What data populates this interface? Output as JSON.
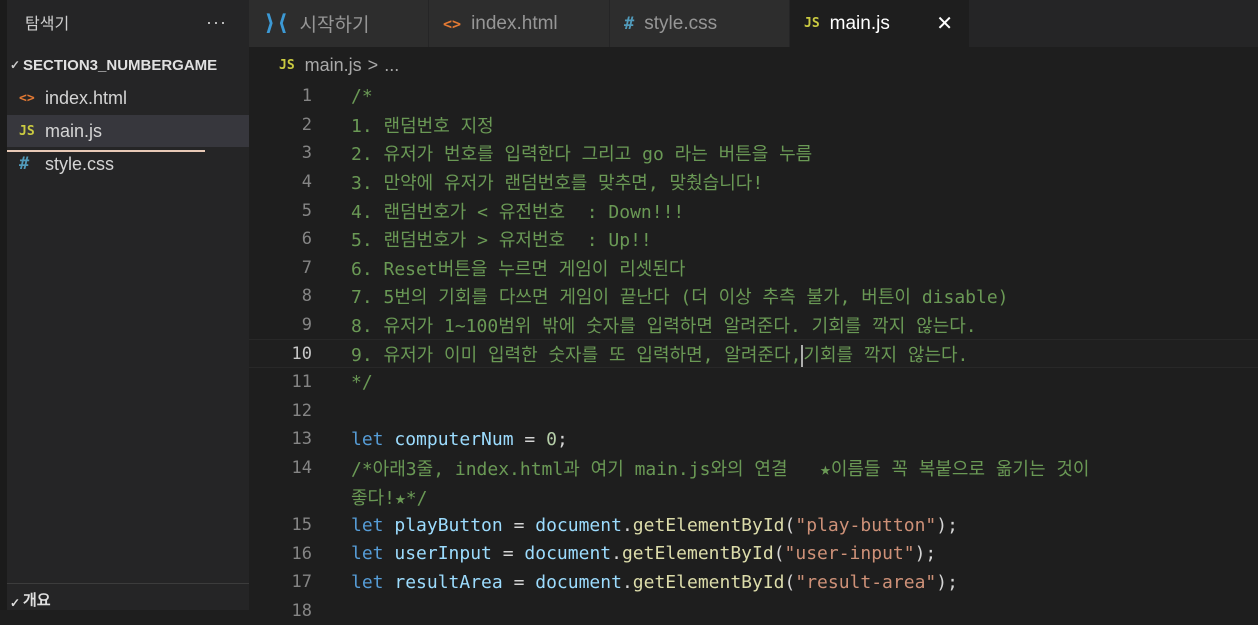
{
  "sidebar": {
    "title": "탐색기",
    "more": "···",
    "folder": "SECTION3_NUMBERGAME",
    "files": [
      {
        "name": "index.html",
        "icon": "<>"
      },
      {
        "name": "main.js",
        "icon": "JS"
      },
      {
        "name": "style.css",
        "icon": "#"
      }
    ],
    "outline": "개요"
  },
  "tabs": [
    {
      "label": "시작하기",
      "icon": "vscode-icon"
    },
    {
      "label": "index.html",
      "icon": "<>"
    },
    {
      "label": "style.css",
      "icon": "#"
    },
    {
      "label": "main.js",
      "icon": "JS",
      "close": "✕"
    }
  ],
  "breadcrumb": {
    "icon": "JS",
    "file": "main.js",
    "sep": ">",
    "rest": "..."
  },
  "editor": {
    "line_numbers": [
      "1",
      "2",
      "3",
      "4",
      "5",
      "6",
      "7",
      "8",
      "9",
      "10",
      "11",
      "12",
      "13",
      "14",
      "15",
      "16",
      "17",
      "18"
    ],
    "comment_lines": [
      "/*",
      "1. 랜덤번호 지정",
      "2. 유저가 번호를 입력한다 그리고 go 라는 버튼을 누름",
      "3. 만약에 유저가 랜덤번호를 맞추면, 맞췄습니다!",
      "4. 랜덤번호가 < 유전번호  : Down!!!",
      "5. 랜덤번호가 > 유저번호  : Up!!",
      "6. Reset버튼을 누르면 게임이 리셋된다",
      "7. 5번의 기회를 다쓰면 게임이 끝난다 (더 이상 추측 불가, 버튼이 disable)",
      "8. 유저가 1~100범위 밖에 숫자를 입력하면 알려준다. 기회를 깍지 않는다.",
      "9. 유저가 이미 입력한 숫자를 또 입력하면, 알려준다,",
      "기회를 깍지 않는다.",
      "*/"
    ],
    "line13": {
      "kw": "let",
      "var": "computerNum",
      "eq": " = ",
      "num": "0",
      "end": ";"
    },
    "line14a": "/*아래3줄, index.html과 여기 main.js와의 연결   ★이름들 꼭 복붙으로 옮기는 것이",
    "line14b": "좋다!★*/",
    "decls": [
      {
        "kw": "let",
        "var": "playButton",
        "eq": " = ",
        "obj": "document",
        "dot": ".",
        "fn": "getElementById",
        "open": "(",
        "str": "\"play-button\"",
        "close": ");"
      },
      {
        "kw": "let",
        "var": "userInput",
        "eq": " = ",
        "obj": "document",
        "dot": ".",
        "fn": "getElementById",
        "open": "(",
        "str": "\"user-input\"",
        "close": ");"
      },
      {
        "kw": "let",
        "var": "resultArea",
        "eq": " = ",
        "obj": "document",
        "dot": ".",
        "fn": "getElementById",
        "open": "(",
        "str": "\"result-area\"",
        "close": ");"
      }
    ]
  }
}
